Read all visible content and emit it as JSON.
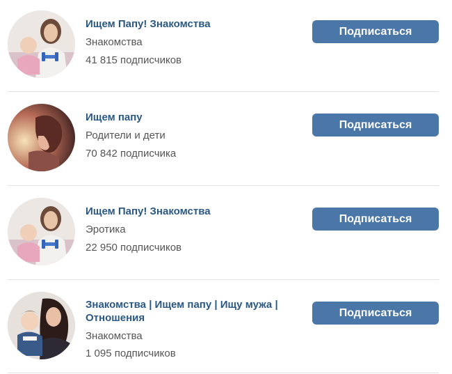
{
  "colors": {
    "link": "#2a5885",
    "button": "#4a76a8",
    "text_secondary": "#555555",
    "divider": "#dfe2e8"
  },
  "groups": [
    {
      "name": "Ищем Папу! Знакомства",
      "category": "Знакомства",
      "subscribers": "41 815   подписчиков",
      "button_label": "Подписаться",
      "avatar": "woman-with-baby-dumbbell"
    },
    {
      "name": "Ищем папу",
      "category": "Родители и дети",
      "subscribers": "70 842 подписчика",
      "button_label": "Подписаться",
      "avatar": "child-profile-sunset"
    },
    {
      "name": "Ищем Папу! Знакомства",
      "category": "Эротика",
      "subscribers": "22 950 подписчиков",
      "button_label": "Подписаться",
      "avatar": "woman-with-baby-dumbbell"
    },
    {
      "name": "Знакомства | Ищем папу | Ищу мужа | Отношения",
      "category": "Знакомства",
      "subscribers": "1 095 подписчиков",
      "button_label": "Подписаться",
      "avatar": "woman-holding-child"
    }
  ]
}
